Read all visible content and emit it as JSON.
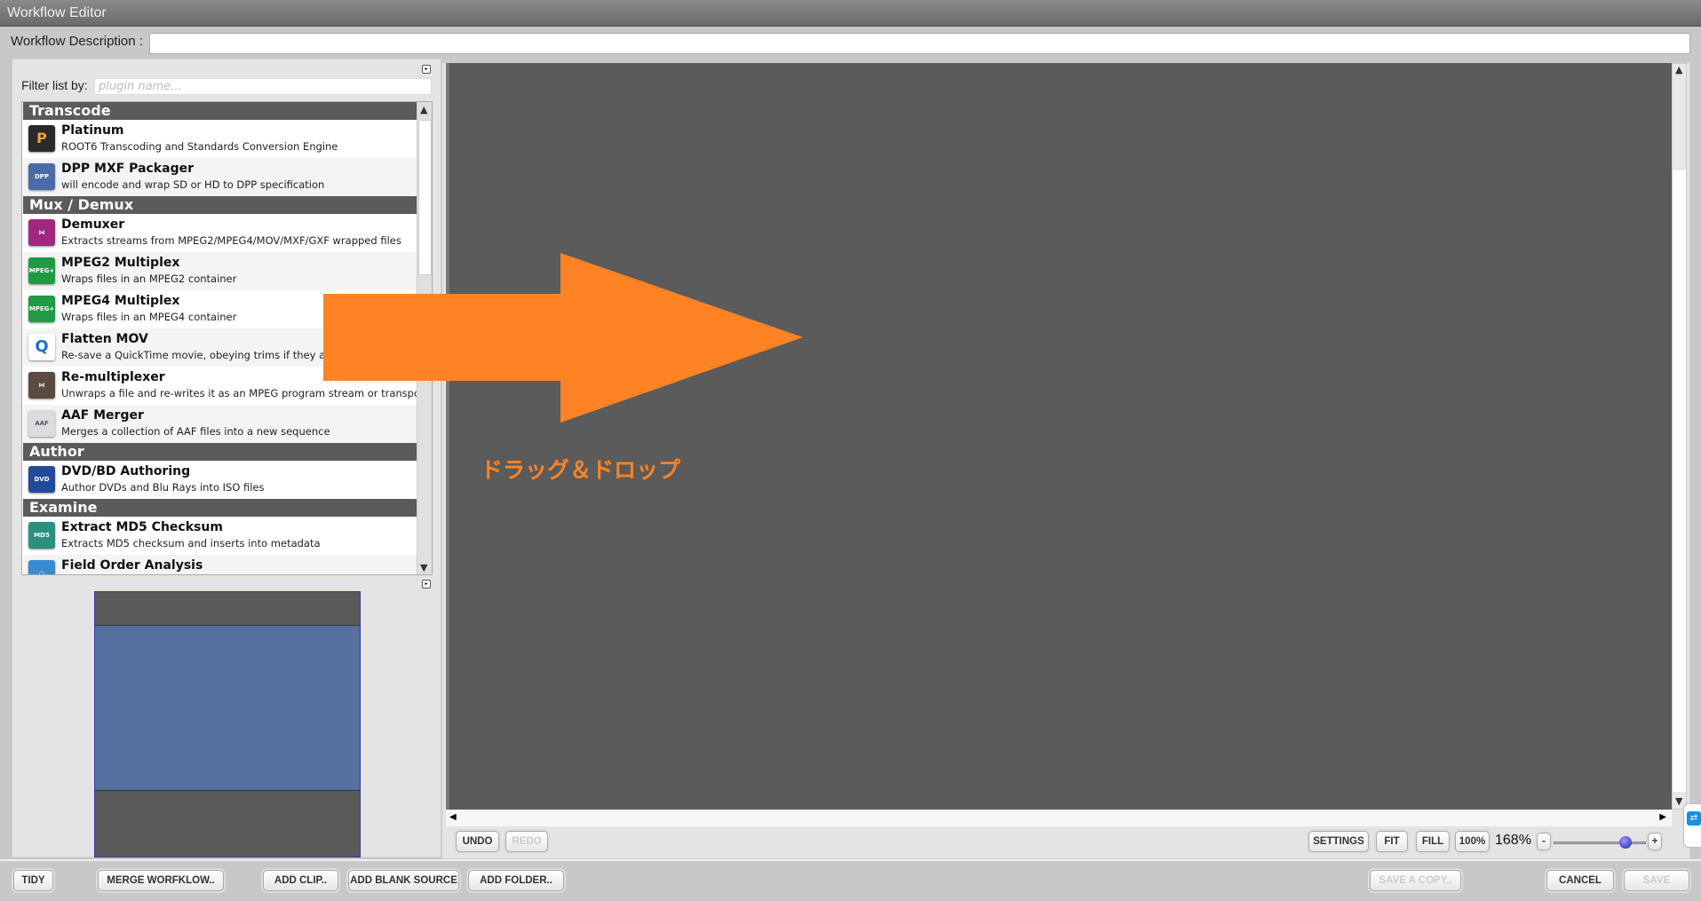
{
  "window": {
    "title": "Workflow Editor"
  },
  "description": {
    "label": "Workflow Description :",
    "value": ""
  },
  "filter": {
    "label": "Filter list by:",
    "placeholder": "plugin name..."
  },
  "categories": [
    {
      "label": "Transcode"
    },
    {
      "label": "Mux / Demux"
    },
    {
      "label": "Author"
    },
    {
      "label": "Examine"
    }
  ],
  "plugins": [
    {
      "name": "Platinum",
      "desc": "ROOT6 Transcoding and Standards Conversion Engine",
      "icon": "platinum-icon",
      "color": "#2a2a2a"
    },
    {
      "name": "DPP MXF Packager",
      "desc": "will encode and wrap SD or HD to DPP specification",
      "icon": "dpp-icon",
      "color": "#4a6aa8"
    },
    {
      "name": "Demuxer",
      "desc": "Extracts streams from MPEG2/MPEG4/MOV/MXF/GXF wrapped files",
      "icon": "demuxer-icon",
      "color": "#a0287e"
    },
    {
      "name": "MPEG2 Multiplex",
      "desc": "Wraps files in an MPEG2 container",
      "icon": "mpeg-multiplex-icon",
      "color": "#1f9a45"
    },
    {
      "name": "MPEG4 Multiplex",
      "desc": "Wraps files in an MPEG4 container",
      "icon": "mpeg-multiplex-icon",
      "color": "#1f9a45"
    },
    {
      "name": "Flatten MOV",
      "desc": "Re-save a QuickTime movie, obeying trims if they are set",
      "icon": "quicktime-icon",
      "color": "#ffffff"
    },
    {
      "name": "Re-multiplexer",
      "desc": "Unwraps a file and re-writes it as an MPEG program stream or transport stream",
      "icon": "remux-icon",
      "color": "#5a4a40"
    },
    {
      "name": "AAF Merger",
      "desc": "Merges a collection of AAF files into a new sequence",
      "icon": "aaf-icon",
      "color": "#dcdcdc"
    },
    {
      "name": "DVD/BD Authoring",
      "desc": "Author DVDs and Blu Rays into ISO files",
      "icon": "dvd-icon",
      "color": "#234a9a"
    },
    {
      "name": "Extract MD5 Checksum",
      "desc": "Extracts MD5 checksum and inserts into metadata",
      "icon": "md5-icon",
      "color": "#2a9080"
    },
    {
      "name": "Field Order Analysis",
      "desc": "",
      "icon": "field-order-icon",
      "color": "#3a8ad0"
    }
  ],
  "icon_text": {
    "dpp": "DPP",
    "mpeg": "MPEG+",
    "aaf": "AAF",
    "dvd": "DVD",
    "md5": "MD5"
  },
  "canvas": {
    "overlay_text": "ドラッグ＆ドロップ",
    "arrow_color": "#ff8324",
    "background": "#5a5b5a"
  },
  "toolbar": {
    "undo": "UNDO",
    "redo": "REDO",
    "settings": "SETTINGS",
    "fit": "FIT",
    "fill": "FILL",
    "actual": "100%",
    "zoom": "168%",
    "zoom_out": "-",
    "zoom_in": "+",
    "zoom_slider_fraction": 0.78
  },
  "footer": {
    "tidy": "TIDY",
    "merge": "MERGE WORFKLOW..",
    "add_clip": "ADD CLIP..",
    "add_blank": "ADD BLANK SOURCE",
    "add_folder": "ADD FOLDER..",
    "save_copy": "SAVE A COPY..",
    "cancel": "CANCEL",
    "save": "SAVE"
  }
}
